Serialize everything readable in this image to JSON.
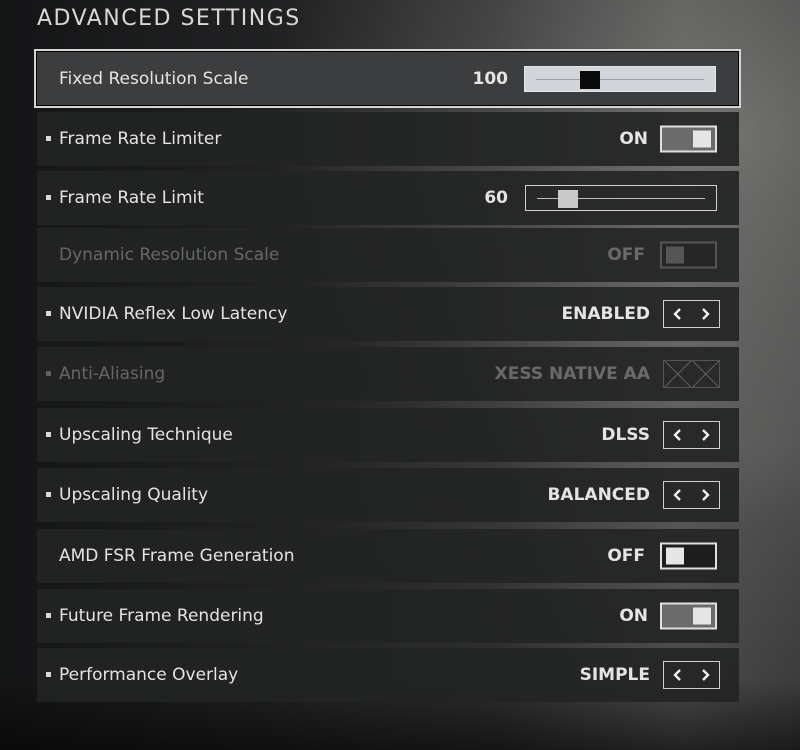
{
  "page": {
    "title": "ADVANCED SETTINGS"
  },
  "settings": {
    "fixed_resolution_scale": {
      "label": "Fixed Resolution Scale",
      "value": "100",
      "slider_fraction": 0.3
    },
    "frame_rate_limiter": {
      "label": "Frame Rate Limiter",
      "value": "ON"
    },
    "frame_rate_limit": {
      "label": "Frame Rate Limit",
      "value": "60",
      "slider_fraction": 0.14
    },
    "dynamic_resolution_scale": {
      "label": "Dynamic Resolution Scale",
      "value": "OFF"
    },
    "nvidia_reflex": {
      "label": "NVIDIA Reflex Low Latency",
      "value": "ENABLED"
    },
    "anti_aliasing": {
      "label": "Anti-Aliasing",
      "value": "XESS NATIVE AA"
    },
    "upscaling_technique": {
      "label": "Upscaling Technique",
      "value": "DLSS"
    },
    "upscaling_quality": {
      "label": "Upscaling Quality",
      "value": "BALANCED"
    },
    "amd_fsr_frame_generation": {
      "label": "AMD FSR Frame Generation",
      "value": "OFF"
    },
    "future_frame_rendering": {
      "label": "Future Frame Rendering",
      "value": "ON"
    },
    "performance_overlay": {
      "label": "Performance Overlay",
      "value": "SIMPLE"
    }
  },
  "icons": {
    "prev": "chevron-left-icon",
    "next": "chevron-right-icon",
    "disabled": "cross-icon"
  },
  "colors": {
    "row_background": "#222324",
    "selected_row_border": "#d4d4d2",
    "text": "#e4e4e2",
    "toggle_on_fill": "#6b6b6c"
  }
}
